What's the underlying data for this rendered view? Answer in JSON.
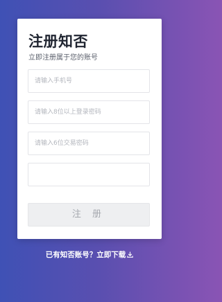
{
  "form": {
    "title": "注册知否",
    "subtitle": "立即注册属于您的账号",
    "phone_placeholder": "请输入手机号",
    "password_placeholder": "请输入8位以上登录密码",
    "trade_password_placeholder": "请输入6位交易密码",
    "captcha_placeholder": "",
    "submit_label": "注 册"
  },
  "footer": {
    "prompt": "已有知否账号？",
    "download_label": "立即下载",
    "download_icon": "download-icon"
  },
  "colors": {
    "gradient_start": "#3f51b5",
    "gradient_end": "#8a54b4",
    "card": "#ffffff",
    "button_bg": "#eeeff1"
  }
}
